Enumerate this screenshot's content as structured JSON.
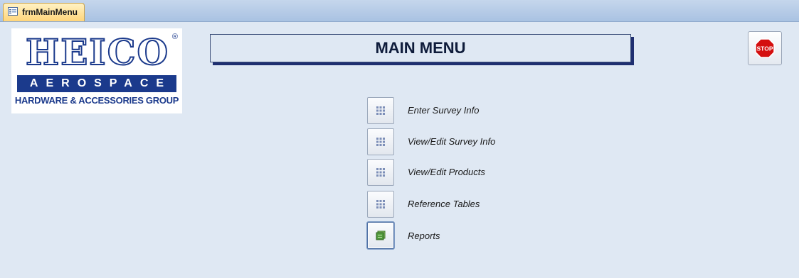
{
  "tab": {
    "label": "frmMainMenu",
    "icon": "form-icon"
  },
  "logo": {
    "brand": "HEICO",
    "registered": "®",
    "band": "AEROSPACE",
    "subtitle": "HARDWARE & ACCESSORIES GROUP",
    "brand_color": "#1b3a8c"
  },
  "title": "MAIN MENU",
  "stop_button": {
    "label": "STOP",
    "icon": "stop-sign-icon",
    "color": "#d40f0f"
  },
  "menu": [
    {
      "label": "Enter Survey Info",
      "icon": "grid-icon"
    },
    {
      "label": "View/Edit Survey Info",
      "icon": "grid-icon"
    },
    {
      "label": "View/Edit Products",
      "icon": "grid-icon"
    },
    {
      "label": "Reference Tables",
      "icon": "grid-icon"
    },
    {
      "label": "Reports",
      "icon": "report-icon"
    }
  ]
}
